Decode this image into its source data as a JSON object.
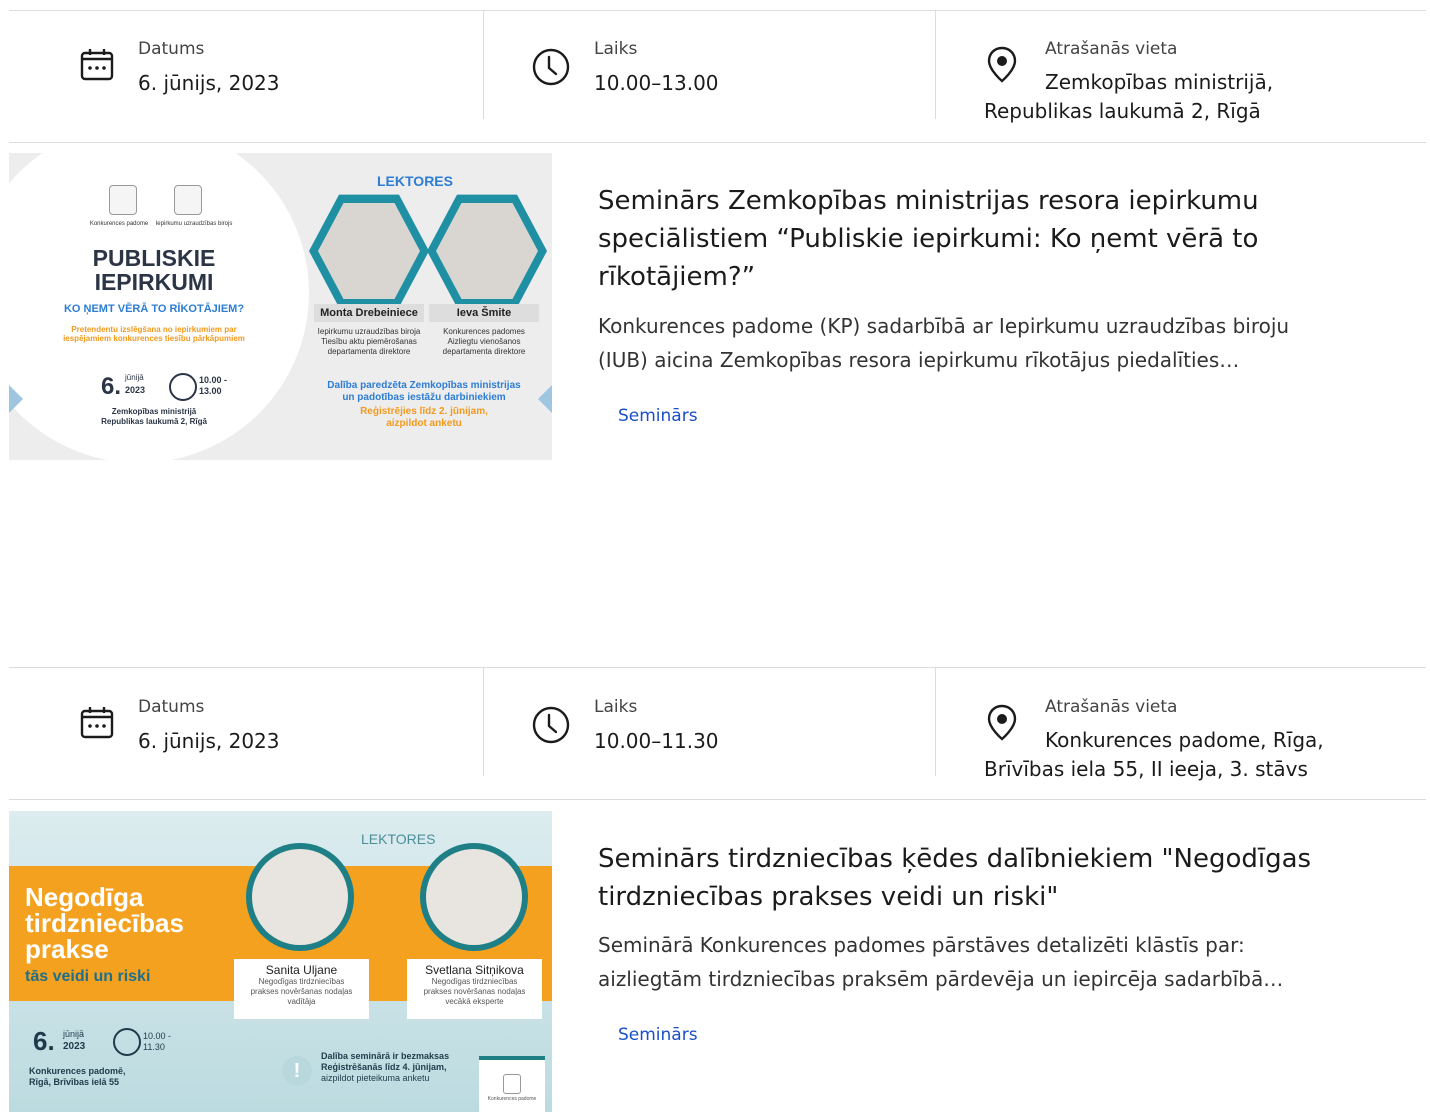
{
  "events": [
    {
      "date_label": "Datums",
      "date_value": "6. jūnijs, 2023",
      "time_label": "Laiks",
      "time_value": "10.00–13.00",
      "location_label": "Atrašanās vieta",
      "location_line1": "Zemkopības ministrijā,",
      "location_line2": "Republikas laukumā 2, Rīgā",
      "title_lines": [
        "Seminārs Zemkopības ministrijas resora iepirkumu",
        "speciālistiem “Publiskie iepirkumi: Ko ņemt vērā to",
        "rīkotājiem?”"
      ],
      "description_lines": [
        "Konkurences padome (KP) sadarbībā ar Iepirkumu uzraudzības biroju",
        "(IUB) aicina Zemkopības resora iepirkumu rīkotājus piedalīties…"
      ],
      "tag": "Seminārs",
      "poster": {
        "org1": "Konkurences padome",
        "org2": "Iepirkumu uzraudzības birojs",
        "heading1": "PUBLISKIE",
        "heading2": "IEPIRKUMI",
        "subheading": "KO ŅEMT VĒRĀ TO RĪKOTĀJIEM?",
        "note1": "Pretendentu izslēgšana no iepirkumiem par",
        "note2": "iespējamiem konkurences tiesību pārkāpumiem",
        "day": "6.",
        "month": "jūnijā",
        "year": "2023",
        "time_from": "10.00 -",
        "time_to": "13.00",
        "place1": "Zemkopības ministrijā",
        "place2": "Republikas laukumā 2, Rīgā",
        "lecturers_label": "LEKTORES",
        "lecturer1_name": "Monta Drebeiniece",
        "lecturer1_role1": "Iepirkumu uzraudzības biroja",
        "lecturer1_role2": "Tiesību aktu piemērošanas",
        "lecturer1_role3": "departamenta direktore",
        "lecturer2_name": "Ieva Šmite",
        "lecturer2_role1": "Konkurences padomes",
        "lecturer2_role2": "Aizliegtu vienošanos",
        "lecturer2_role3": "departamenta direktore",
        "cta1": "Dalība paredzēta Zemkopības ministrijas",
        "cta2": "un padotības iestāžu darbiniekiem",
        "cta3": "Reģistrējies līdz 2. jūnijam,",
        "cta4": "aizpildot anketu"
      }
    },
    {
      "date_label": "Datums",
      "date_value": "6. jūnijs, 2023",
      "time_label": "Laiks",
      "time_value": "10.00–11.30",
      "location_label": "Atrašanās vieta",
      "location_line1": "Konkurences padome, Rīga,",
      "location_line2": "Brīvības iela 55, II ieeja, 3. stāvs",
      "title_lines": [
        "Seminārs tirdzniecības ķēdes dalībniekiem \"Negodīgas",
        "tirdzniecības prakses veidi un riski\""
      ],
      "description_lines": [
        "Seminārā Konkurences padomes pārstāves detalizēti klāstīs par:",
        "aizliegtām tirdzniecības praksēm pārdevēja un iepircēja sadarbībā…"
      ],
      "tag": "Seminārs",
      "poster": {
        "lecturers_label": "LEKTORES",
        "heading1": "Negodīga",
        "heading2": "tirdzniecības",
        "heading3": "prakse",
        "subheading": "tās veidi un riski",
        "lecturer1_name": "Sanita Uljane",
        "lecturer1_role1": "Negodīgas tirdzniecības",
        "lecturer1_role2": "prakses novēršanas nodaļas",
        "lecturer1_role3": "vadītāja",
        "lecturer2_name": "Svetlana Sitņikova",
        "lecturer2_role1": "Negodīgas tirdzniecības",
        "lecturer2_role2": "prakses novēršanas nodaļas",
        "lecturer2_role3": "vecākā eksperte",
        "day": "6.",
        "month": "jūnijā",
        "year": "2023",
        "time_from": "10.00 -",
        "time_to": "11.30",
        "place1": "Konkurences padomē,",
        "place2": "Rīgā, Brīvības ielā 55",
        "cta1": "Dalība seminārā ir bezmaksas",
        "cta2": "Reģistrēšanās līdz 4. jūnijam,",
        "cta3": "aizpildot pieteikuma anketu",
        "org": "Konkurences padome"
      }
    }
  ],
  "colors": {
    "link": "#1a4fc9",
    "divider": "#dcdcdc",
    "orange": "#f3a11f",
    "teal": "#1f8fa4"
  }
}
